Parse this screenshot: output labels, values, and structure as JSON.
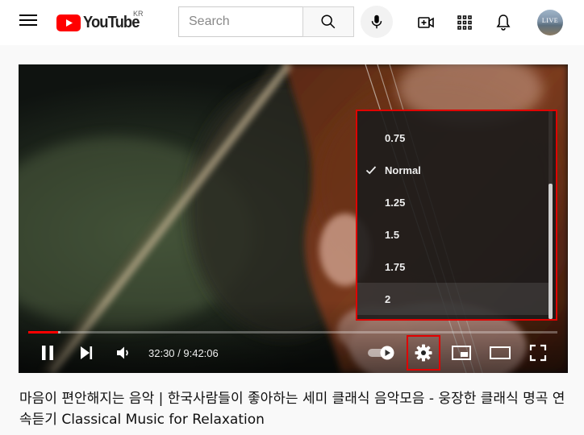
{
  "header": {
    "logo_text": "YouTube",
    "region": "KR",
    "search_placeholder": "Search",
    "avatar_text": "LIVE"
  },
  "player": {
    "time": "32:30 / 9:42:06",
    "progress_fraction": 0.0557,
    "settings_menu": {
      "items": [
        {
          "label": "0.75"
        },
        {
          "label": "Normal"
        },
        {
          "label": "1.25"
        },
        {
          "label": "1.5"
        },
        {
          "label": "1.75"
        },
        {
          "label": "2"
        }
      ]
    }
  },
  "video": {
    "title": "마음이 편안해지는 음악 | 한국사람들이 좋아하는 세미 클래식 음악모음 - 웅장한 클래식 명곡 연속듣기 Classical Music for Relaxation"
  },
  "colors": {
    "accent_red": "#ff0000",
    "highlight_red": "#e00000"
  }
}
